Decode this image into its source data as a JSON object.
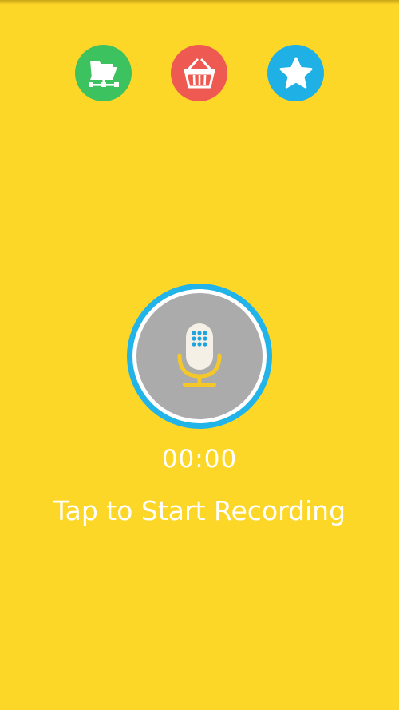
{
  "colors": {
    "background": "#FDD728",
    "files_button": "#3CC25F",
    "shop_button": "#EE5A51",
    "star_button": "#1FB1E6",
    "ring": "#22B3E8",
    "record_inner": "#ABABAB",
    "mic_body": "#F4F0E6",
    "mic_dots": "#1FA3E0",
    "mic_stand": "#F5C82A",
    "text": "#FFFFFF"
  },
  "toolbar": {
    "files_icon": "folder-network-icon",
    "shop_icon": "shopping-basket-icon",
    "star_icon": "star-icon"
  },
  "recorder": {
    "mic_icon": "microphone-icon",
    "timer": "00:00",
    "hint": "Tap to Start Recording"
  }
}
